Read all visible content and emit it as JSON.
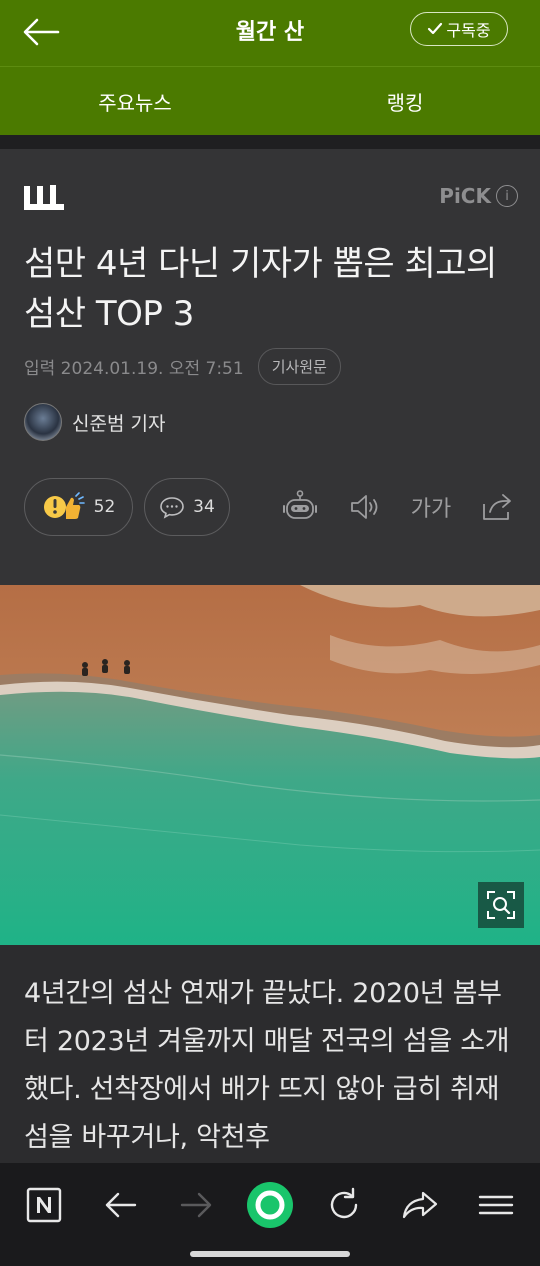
{
  "header": {
    "title": "월간 산",
    "subscribe_label": "구독중"
  },
  "tabs": [
    {
      "label": "주요뉴스"
    },
    {
      "label": "랭킹"
    }
  ],
  "article": {
    "press_logo": "산",
    "pick_label": "PiCK",
    "headline": "섬만 4년 다닌 기자가 뽑은 최고의 섬산 TOP 3",
    "date": "입력 2024.01.19. 오전 7:51",
    "original_label": "기사원문",
    "author": "신준범 기자",
    "reaction_count": "52",
    "comment_count": "34",
    "font_size_label": "가가",
    "body": "4년간의 섬산 연재가 끝났다. 2020년 봄부터 2023년 겨울까지 매달 전국의 섬을 소개했다. 선착장에서 배가 뜨지 않아 급히 취재 섬을 바꾸거나, 악천후"
  },
  "colors": {
    "brand_green": "#4b7a00",
    "background": "#343436",
    "browser_home_green": "#19c56b"
  },
  "icons": [
    "back-arrow-icon",
    "check-icon",
    "info-icon",
    "reaction-emoji-icon",
    "comment-icon",
    "robot-summary-icon",
    "speaker-icon",
    "font-size-icon",
    "share-icon",
    "zoom-icon",
    "naver-n-icon",
    "browser-back-icon",
    "browser-forward-icon",
    "home-icon",
    "refresh-icon",
    "browser-share-icon",
    "menu-icon"
  ]
}
